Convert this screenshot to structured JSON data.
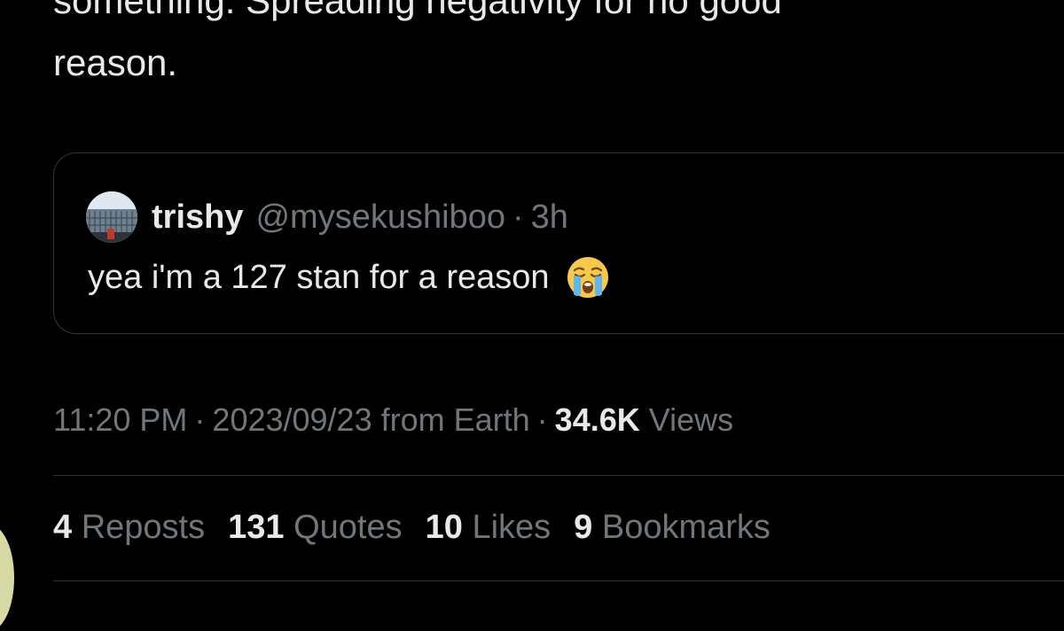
{
  "tweet": {
    "text_line1": "something. Spreading negativity for no good",
    "text_line2": "reason."
  },
  "quote": {
    "name": "trishy",
    "handle": "@mysekushiboo",
    "separator": "·",
    "time": "3h",
    "text": "yea i'm a 127 stan for a reason",
    "emoji_icon": "loudly-crying-face-icon"
  },
  "meta": {
    "time": "11:20 PM",
    "separator": "·",
    "date": "2023/09/23",
    "source": "from Earth",
    "views_count": "34.6K",
    "views_label": "Views"
  },
  "stats": {
    "reposts_count": "4",
    "reposts_label": "Reposts",
    "quotes_count": "131",
    "quotes_label": "Quotes",
    "likes_count": "10",
    "likes_label": "Likes",
    "bookmarks_count": "9",
    "bookmarks_label": "Bookmarks"
  },
  "colors": {
    "background": "#000000",
    "primary_text": "#e7e9ea",
    "secondary_text": "#71767b",
    "border": "#333639"
  }
}
